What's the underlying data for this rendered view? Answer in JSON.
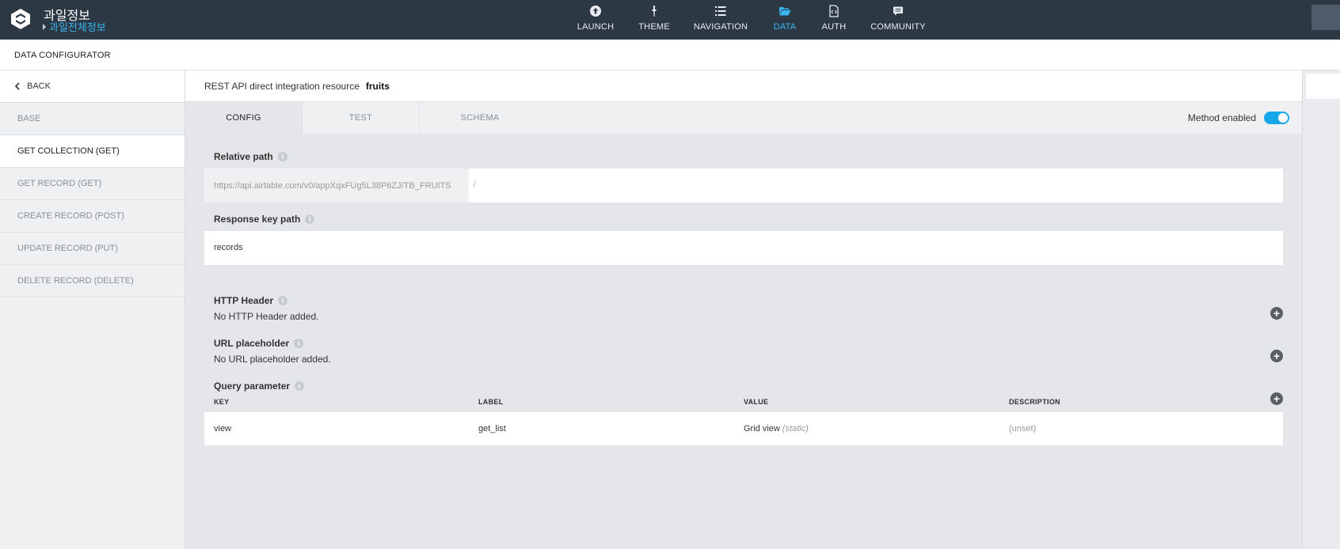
{
  "app": {
    "title": "과일정보",
    "subtitle": "과일전체정보"
  },
  "nav": [
    {
      "label": "LAUNCH",
      "icon": "upload-circle-icon"
    },
    {
      "label": "THEME",
      "icon": "brush-icon"
    },
    {
      "label": "NAVIGATION",
      "icon": "list-icon"
    },
    {
      "label": "DATA",
      "icon": "folder-open-icon"
    },
    {
      "label": "AUTH",
      "icon": "file-code-icon"
    },
    {
      "label": "COMMUNITY",
      "icon": "comment-icon"
    }
  ],
  "nav_active": "DATA",
  "subheader": {
    "title": "DATA CONFIGURATOR"
  },
  "sidebar": {
    "back_label": "BACK",
    "items": [
      {
        "label": "BASE"
      },
      {
        "label": "GET COLLECTION (GET)"
      },
      {
        "label": "GET RECORD (GET)"
      },
      {
        "label": "CREATE RECORD (POST)"
      },
      {
        "label": "UPDATE RECORD (PUT)"
      },
      {
        "label": "DELETE RECORD (DELETE)"
      }
    ],
    "active": "GET COLLECTION (GET)"
  },
  "resource": {
    "label": "REST API direct integration resource",
    "name": "fruits"
  },
  "tabs": [
    {
      "label": "CONFIG"
    },
    {
      "label": "TEST"
    },
    {
      "label": "SCHEMA"
    }
  ],
  "tab_active": "CONFIG",
  "method_enabled": {
    "label": "Method enabled",
    "value": true
  },
  "relative_path": {
    "label": "Relative path",
    "prefix": "https://api.airtable.com/v0/appXqxFUg5L38P6ZJ/TB_FRUITS",
    "separator": "/",
    "value": ""
  },
  "response_key_path": {
    "label": "Response key path",
    "value": "records"
  },
  "http_header": {
    "label": "HTTP Header",
    "empty_text": "No HTTP Header added."
  },
  "url_placeholder": {
    "label": "URL placeholder",
    "empty_text": "No URL placeholder added."
  },
  "query_parameter": {
    "label": "Query parameter",
    "columns": [
      "KEY",
      "LABEL",
      "VALUE",
      "DESCRIPTION"
    ],
    "rows": [
      {
        "key": "view",
        "label": "get_list",
        "value": "Grid view",
        "value_note": "(static)",
        "description": "(unset)"
      }
    ]
  },
  "colors": {
    "topbar": "#2d3845",
    "accent": "#39b4ef",
    "toggle": "#16a7ea"
  }
}
